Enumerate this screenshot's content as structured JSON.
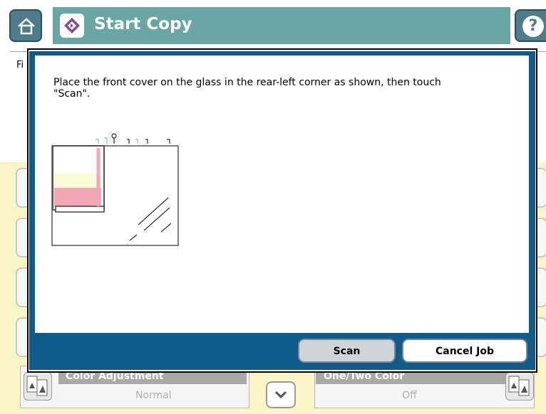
{
  "header": {
    "title": "Start Copy",
    "home_icon": "home-icon",
    "start_icon": "start-diamond-icon",
    "help_label": "?"
  },
  "background": {
    "partial_label": "Fi",
    "color_adjustment": {
      "label": "Color Adjustment",
      "value": "Normal"
    },
    "one_two_color": {
      "label": "One/Two Color",
      "value": "Off"
    }
  },
  "dialog": {
    "instruction": "Place the front cover on the glass in the rear-left corner as shown, then touch\n\"Scan\".",
    "scan_label": "Scan",
    "cancel_label": "Cancel Job"
  },
  "colors": {
    "header_teal": "#6aa6a3",
    "dialog_frame": "#0f5b8a",
    "page_yellow": "#faf5c6",
    "scan_button": "#cfd4d8"
  }
}
